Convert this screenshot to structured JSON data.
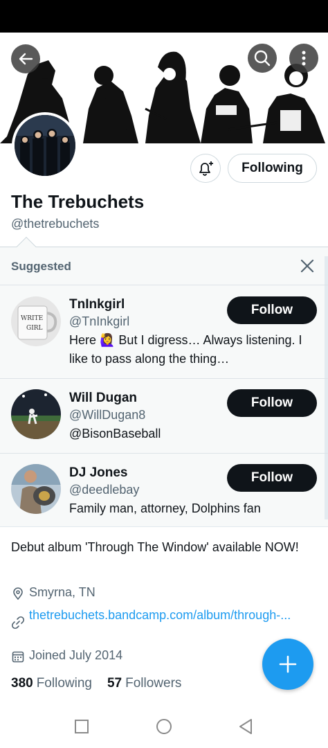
{
  "profile": {
    "name": "The Trebuchets",
    "handle": "@thetrebuchets",
    "following_button": "Following",
    "bio": "Debut album 'Through The Window' available NOW!",
    "location": "Smyrna, TN",
    "link": "thetrebuchets.bandcamp.com/album/through-...",
    "joined": "Joined July 2014",
    "following_count": "380",
    "following_label": "Following",
    "followers_count": "57",
    "followers_label": "Followers"
  },
  "suggested": {
    "header": "Suggested",
    "follow_label": "Follow",
    "accounts": [
      {
        "name": "TnInkgirl",
        "handle": "@TnInkgirl",
        "bio": "Here 🙋‍♀️ But I digress… Always listening. I like to pass along  the thing…"
      },
      {
        "name": "Will Dugan",
        "handle": "@WillDugan8",
        "bio": "@BisonBaseball"
      },
      {
        "name": "DJ Jones",
        "handle": "@deedlebay",
        "bio": "Family man, attorney, Dolphins fan"
      }
    ]
  },
  "icons": {
    "back": "arrow-left-icon",
    "search": "search-icon",
    "more": "more-vertical-icon",
    "notify": "bell-plus-icon",
    "close": "close-icon",
    "location": "location-pin-icon",
    "link": "link-icon",
    "calendar": "calendar-icon",
    "compose": "plus-icon"
  },
  "colors": {
    "accent": "#1d9bf0",
    "text": "#0f1419",
    "secondary": "#536471",
    "panel": "#f7f9f9"
  }
}
